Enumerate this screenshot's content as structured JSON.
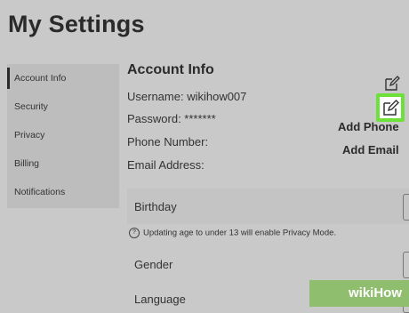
{
  "page_title": "My Settings",
  "sidebar": {
    "items": [
      {
        "label": "Account Info",
        "active": true
      },
      {
        "label": "Security"
      },
      {
        "label": "Privacy"
      },
      {
        "label": "Billing"
      },
      {
        "label": "Notifications"
      }
    ]
  },
  "account": {
    "title": "Account Info",
    "username": "Username: wikihow007",
    "password": "Password: *******",
    "phone_label": "Phone Number:",
    "email_label": "Email Address:",
    "add_phone": "Add Phone",
    "add_email": "Add Email"
  },
  "fields": {
    "birthday": "Birthday",
    "notice": "Updating age to under 13 will enable Privacy Mode.",
    "gender": "Gender",
    "language": "Language"
  },
  "colors": {
    "highlight": "#6ee03a",
    "background": "#c9c9c9"
  },
  "watermark": "wikiHow"
}
